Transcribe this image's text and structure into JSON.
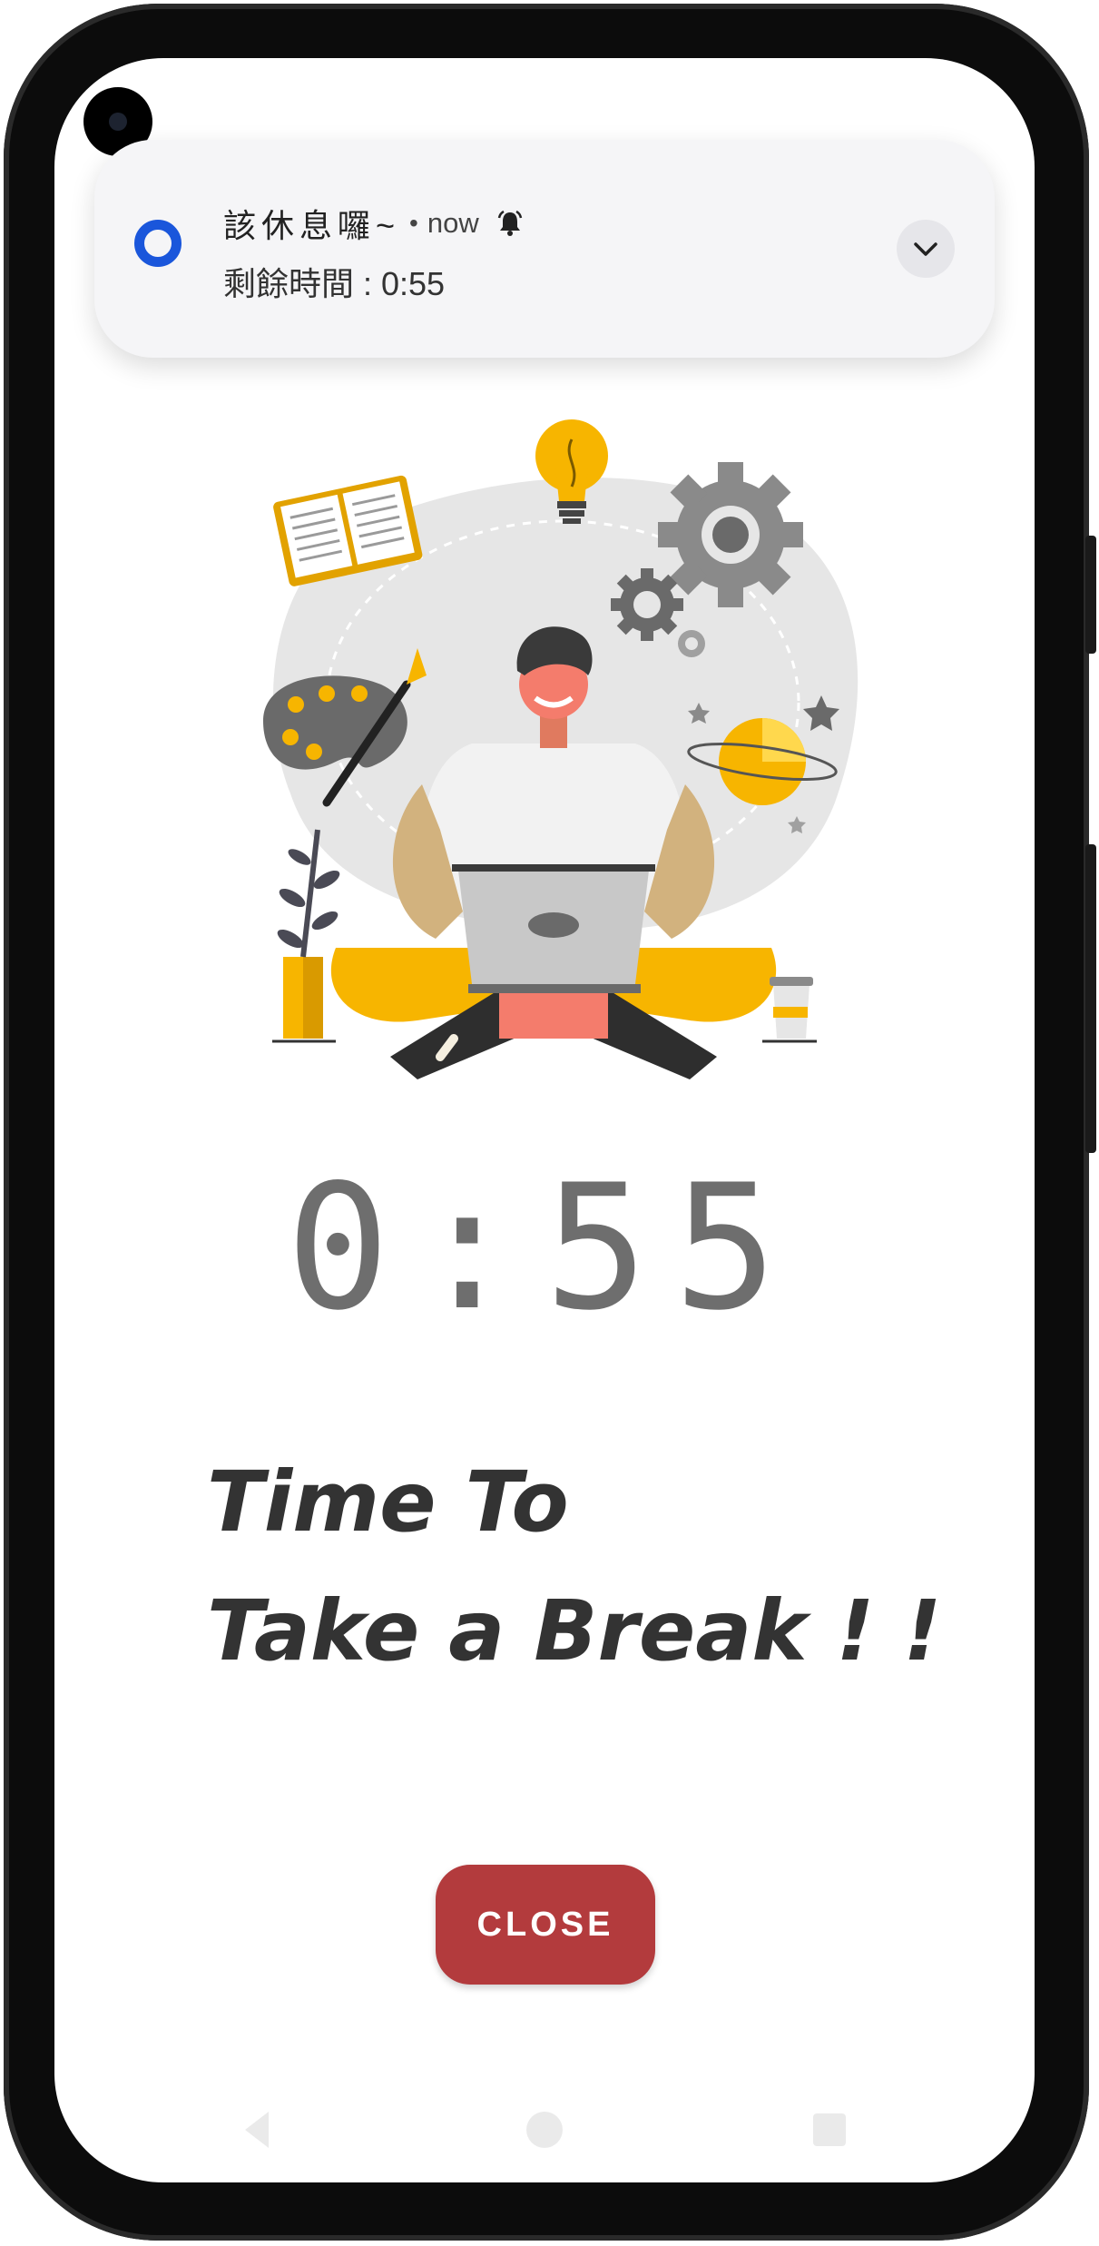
{
  "notification": {
    "title": "該休息囉~",
    "separator": "•",
    "time": "now",
    "text": "剩餘時間 : 0:55",
    "app_icon": "ring-icon",
    "alarm_icon": "alarm-bell-icon",
    "expand_icon": "chevron-down-icon"
  },
  "illustration": {
    "name": "person-with-laptop-illustration"
  },
  "timer": {
    "value": "0:55"
  },
  "headline": {
    "line1": "Time To",
    "line2": "Take a Break ! !"
  },
  "close_button": {
    "label": "CLOSE"
  },
  "colors": {
    "accent": "#b33b3d",
    "notification_icon": "#1a56db",
    "timer_text": "#6e6e6e",
    "headline_text": "#333333",
    "illustration_yellow": "#f7b500"
  },
  "nav_bar": {
    "icons": [
      "back-icon",
      "home-icon",
      "recents-icon"
    ]
  }
}
